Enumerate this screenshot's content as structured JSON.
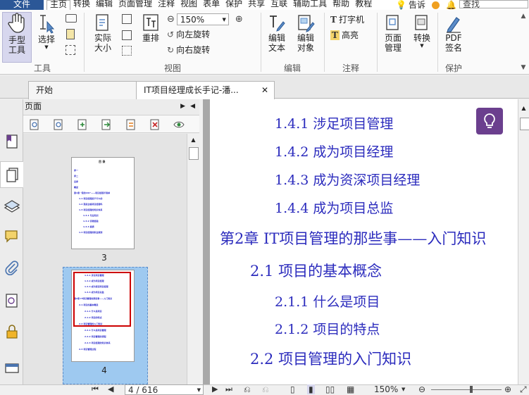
{
  "menubar": {
    "file_label": "文件",
    "items": [
      "主页",
      "转换",
      "编辑",
      "页面管理",
      "注释",
      "视图",
      "表单",
      "保护",
      "共享",
      "互联",
      "辅助工具",
      "帮助",
      "教程"
    ],
    "tell_me": "告诉",
    "search_value": "查找"
  },
  "ribbon": {
    "hand_tool": "手型\n工具",
    "select": "选择",
    "actual_size": "实际\n大小",
    "reflow": "重排",
    "zoom_value": "150%",
    "rotate_left": "向左旋转",
    "rotate_right": "向右旋转",
    "edit_text": "编辑\n文本",
    "edit_object": "编辑\n对象",
    "typewriter": "打字机",
    "highlight": "高亮",
    "page_manage": "页面\n管理",
    "convert": "转换",
    "pdf_sign": "PDF\n签名",
    "groups": {
      "tools": "工具",
      "view": "视图",
      "edit": "编辑",
      "comment": "注释",
      "protect": "保护"
    }
  },
  "tabs": {
    "start": "开始",
    "document": "IT项目经理成长手记-潘..."
  },
  "panel": {
    "title": "页面",
    "thumb3_label": "3",
    "thumb4_label": "4",
    "thumb3_lines": [
      "目 录",
      "序一",
      "序二",
      "自序",
      "概述",
      "第1章  \"我的CIO\"——项目经理不简单",
      "1.1   项目经理是干什么的",
      "1.2   我是合格项目经理吗",
      "1.3   项目经理的知识体系",
      "1.3.1   专业知识",
      "1.3.2   实践经验",
      "1.3.3   素质",
      "1.4   项目经理的职业规划"
    ],
    "thumb4_lines": [
      "1.4.1  涉足项目管理",
      "1.4.2  成为项目经理",
      "1.4.3  成为资深项目经理",
      "1.4.4  成为项目总监",
      "第2章  IT项目管理的那些事——入门知识",
      "2.1  项目的基本概念",
      "2.1.1  什么是项目",
      "2.1.2  项目的特点",
      "2.2  项目管理的入门知识",
      "2.2.1  什么是项目管理",
      "2.2.2  项目管理的流程",
      "2.2.3  项目经理的知识体系",
      "2.3  项目管理过程"
    ]
  },
  "document": {
    "lines": [
      {
        "text": "1.4.1   涉足项目管理"
      },
      {
        "text": "1.4.2   成为项目经理"
      },
      {
        "text": "1.4.3   成为资深项目经理"
      },
      {
        "text": "1.4.4   成为项目总监"
      },
      {
        "text": "第2章   IT项目管理的那些事——入门知识"
      },
      {
        "text": "2.1   项目的基本概念"
      },
      {
        "text": "2.1.1   什么是项目"
      },
      {
        "text": "2.1.2   项目的特点"
      },
      {
        "text": "2.2   项目管理的入门知识"
      }
    ]
  },
  "status": {
    "page_value": "4 / 616",
    "zoom": "150%"
  },
  "colors": {
    "accent": "#2b5797",
    "link_text": "#2b2bbd",
    "selection": "#9ec9f0",
    "highlight_box": "#cc0000",
    "idea_bg": "#6b3f8e"
  }
}
